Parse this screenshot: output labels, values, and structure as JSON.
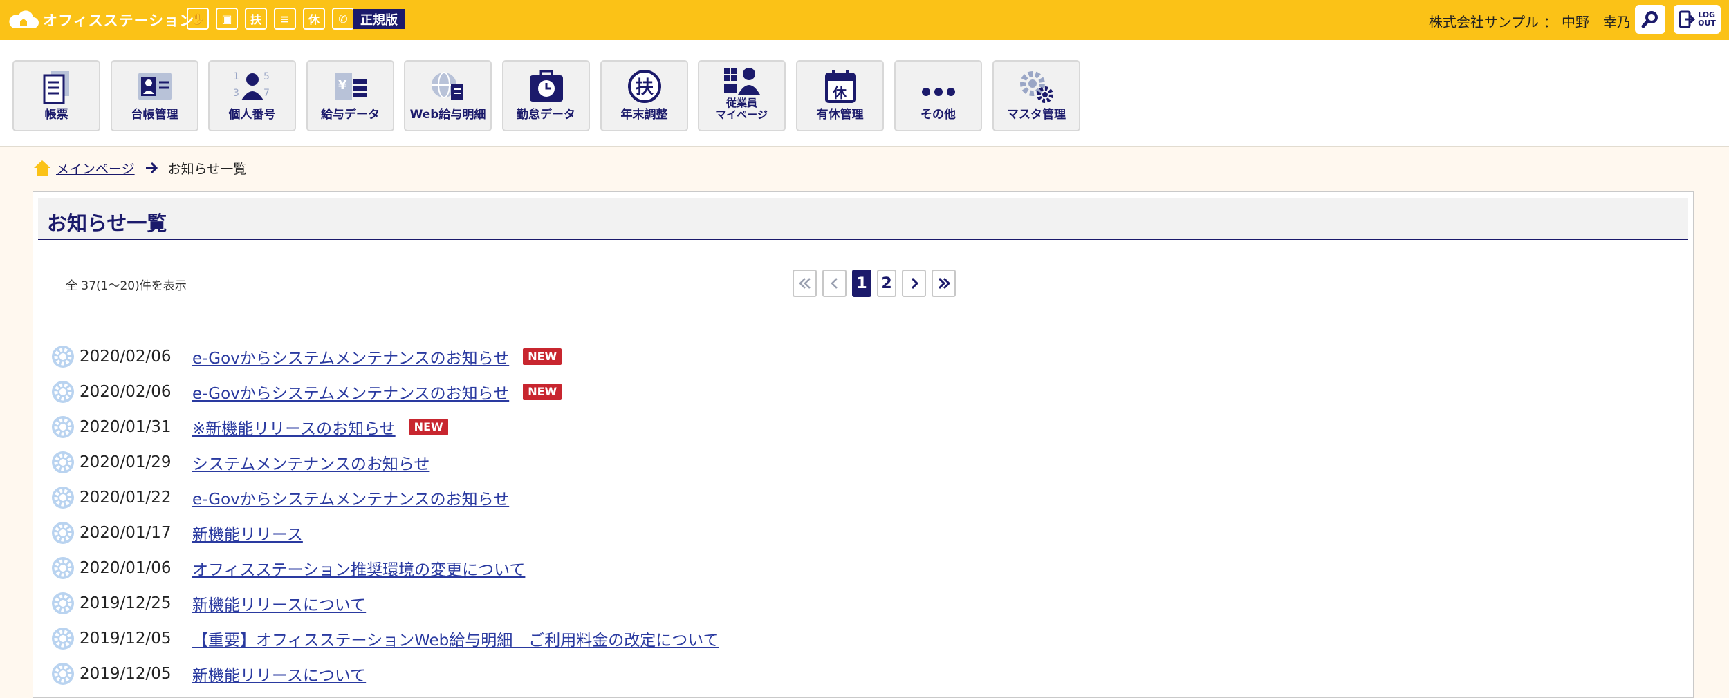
{
  "header": {
    "brand": "オフィスステーション",
    "mini_icons": [
      "stamp-icon",
      "briefcase-icon",
      "fu-circle-icon",
      "scroll-icon",
      "kyu-icon",
      "phone-icon"
    ],
    "edition": "正規版",
    "user": "株式会社サンプル ： 中野　幸乃",
    "logout_line1": "LOG",
    "logout_line2": "OUT"
  },
  "nav": [
    {
      "label": "帳票",
      "icon": "document-icon"
    },
    {
      "label": "台帳管理",
      "icon": "id-card-icon"
    },
    {
      "label": "個人番号",
      "icon": "person-number-icon"
    },
    {
      "label": "給与データ",
      "icon": "yen-list-icon"
    },
    {
      "label": "Web給与明細",
      "icon": "globe-document-icon"
    },
    {
      "label": "勤怠データ",
      "icon": "clock-bag-icon"
    },
    {
      "label": "年末調整",
      "icon": "fu-badge-icon"
    },
    {
      "label_1": "従業員",
      "label_2": "マイページ",
      "icon": "employees-icon"
    },
    {
      "label": "有休管理",
      "icon": "calendar-kyu-icon"
    },
    {
      "label": "その他",
      "icon": "dots-icon"
    },
    {
      "label": "マスタ管理",
      "icon": "gears-icon"
    }
  ],
  "breadcrumb": {
    "home": "メインページ",
    "current": "お知らせ一覧"
  },
  "panel": {
    "title": "お知らせ一覧",
    "count": "全 37(1〜20)件を表示",
    "pager": {
      "first": "«",
      "prev": "‹",
      "pages": [
        "1",
        "2"
      ],
      "current_page": "1",
      "next": "›",
      "last": "»"
    }
  },
  "news": [
    {
      "date": "2020/02/06",
      "title": "e-Govからシステムメンテナンスのお知らせ",
      "new": "NEW"
    },
    {
      "date": "2020/02/06",
      "title": "e-Govからシステムメンテナンスのお知らせ",
      "new": "NEW"
    },
    {
      "date": "2020/01/31",
      "title": "※新機能リリースのお知らせ",
      "new": "NEW"
    },
    {
      "date": "2020/01/29",
      "title": "システムメンテナンスのお知らせ"
    },
    {
      "date": "2020/01/22",
      "title": "e-Govからシステムメンテナンスのお知らせ"
    },
    {
      "date": "2020/01/17",
      "title": "新機能リリース"
    },
    {
      "date": "2020/01/06",
      "title": "オフィスステーション推奨環境の変更について"
    },
    {
      "date": "2019/12/25",
      "title": "新機能リリースについて"
    },
    {
      "date": "2019/12/05",
      "title": "【重要】オフィスステーションWeb給与明細　ご利用料金の改定について"
    },
    {
      "date": "2019/12/05",
      "title": "新機能リリースについて"
    }
  ],
  "colors": {
    "topbar": "#fbc217",
    "navy": "#1b1a6b",
    "link": "#2a3aa0",
    "new_badge": "#c8262f",
    "page_bg": "#fff8ef"
  }
}
